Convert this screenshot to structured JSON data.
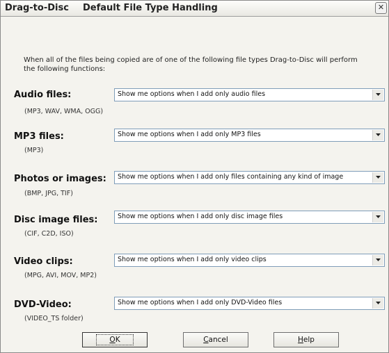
{
  "window": {
    "tab_title_1": "Drag-to-Disc",
    "tab_title_2": "Default File Type Handling",
    "close_glyph": "✕"
  },
  "intro_text": "When all of the files being copied are of one of the following file types Drag-to-Disc will perform the following functions:",
  "rows": [
    {
      "label": "Audio files:",
      "extensions": "(MP3, WAV, WMA, OGG)",
      "selected": "Show me options when I add only audio files"
    },
    {
      "label": "MP3 files:",
      "extensions": "(MP3)",
      "selected": "Show me options when I add only MP3 files"
    },
    {
      "label": "Photos or images:",
      "extensions": "(BMP, JPG, TIF)",
      "selected": "Show me options when I add only files containing any kind of image"
    },
    {
      "label": "Disc image files:",
      "extensions": "(CIF, C2D, ISO)",
      "selected": "Show me options when I add only disc image files"
    },
    {
      "label": "Video clips:",
      "extensions": "(MPG, AVI, MOV, MP2)",
      "selected": "Show me options when I add only video clips"
    },
    {
      "label": "DVD-Video:",
      "extensions": "(VIDEO_TS folder)",
      "selected": "Show me options when I add only DVD-Video files"
    }
  ],
  "buttons": {
    "ok": {
      "pre": "",
      "underlined": "O",
      "post": "K"
    },
    "cancel": {
      "pre": "",
      "underlined": "C",
      "post": "ancel"
    },
    "help": {
      "pre": "",
      "underlined": "H",
      "post": "elp"
    }
  }
}
